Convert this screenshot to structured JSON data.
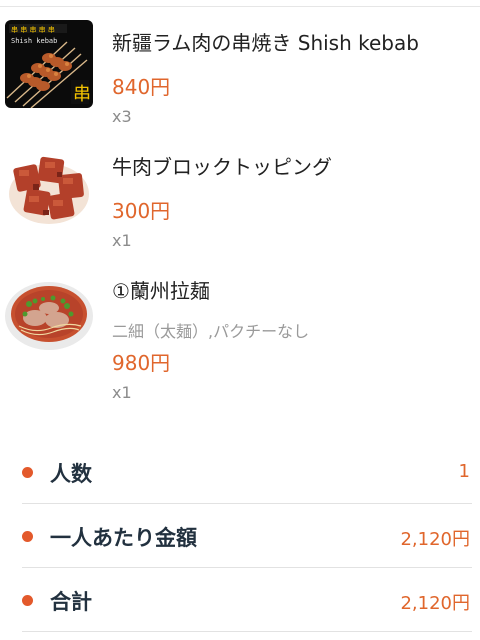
{
  "order": {
    "items": [
      {
        "name": "新疆ラム肉の串焼き Shish kebab",
        "image_text": "Shish kebab",
        "price": "840円",
        "qty": "x3"
      },
      {
        "name": "牛肉ブロックトッピング",
        "price": "300円",
        "qty": "x1"
      },
      {
        "name": "①蘭州拉麺",
        "option": "二細（太麺）,パクチーなし",
        "price": "980円",
        "qty": "x1"
      }
    ]
  },
  "summary": {
    "rows": [
      {
        "label": "人数",
        "value": "1"
      },
      {
        "label": "一人あたり金額",
        "value": "2,120円"
      },
      {
        "label": "合計",
        "value": "2,120円"
      }
    ]
  },
  "colors": {
    "accent": "#e0662c",
    "dot": "#e3592b",
    "label": "#22313f"
  }
}
